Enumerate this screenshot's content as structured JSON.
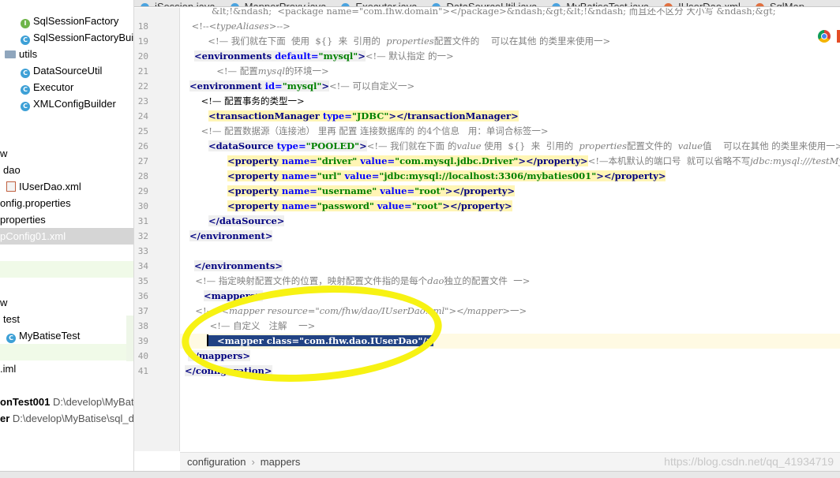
{
  "tabs": [
    {
      "label": "iSession.java"
    },
    {
      "label": "MapperProxy.java"
    },
    {
      "label": "Executor.java"
    },
    {
      "label": "DataSourceUtil.java"
    },
    {
      "label": "MyBatiseTest.java"
    },
    {
      "label": "IUserDao.xml"
    },
    {
      "label": "SqlMap"
    }
  ],
  "tree": {
    "items": [
      {
        "label": "SqlSessionFactory",
        "icon": "interface-icon"
      },
      {
        "label": "SqlSessionFactoryBuil",
        "icon": "class-icon"
      },
      {
        "label": "utils",
        "icon": "folder-icon"
      },
      {
        "label": "DataSourceUtil",
        "icon": "class-icon"
      },
      {
        "label": "Executor",
        "icon": "class-icon"
      },
      {
        "label": "XMLConfigBuilder",
        "icon": "class-icon"
      },
      {
        "label": "w"
      },
      {
        "label": "dao"
      },
      {
        "label": "IUserDao.xml",
        "icon": "xml-icon"
      },
      {
        "label": "onfig.properties"
      },
      {
        "label": "properties"
      },
      {
        "label": "pConfig01.xml"
      },
      {
        "label": "w"
      },
      {
        "label": "test"
      },
      {
        "label": "MyBatiseTest",
        "icon": "class-icon"
      },
      {
        "label": ".iml"
      }
    ],
    "projects": [
      {
        "name": "onTest001",
        "path": "D:\\develop\\MyBat"
      },
      {
        "name": "er",
        "path": "D:\\develop\\MyBatise\\sql_d"
      }
    ]
  },
  "editor": {
    "line_numbers": [
      "18",
      "19",
      "20",
      "21",
      "22",
      "23",
      "24",
      "25",
      "26",
      "27",
      "28",
      "29",
      "30",
      "31",
      "32",
      "33",
      "34",
      "35",
      "36",
      "37",
      "38",
      "39",
      "40",
      "41"
    ],
    "top_partial": "&lt;!&ndash;  <package name=\"com.fhw.domain\"></package>&ndash;&gt;&lt;!&ndash; 而且还不区分 大小写 &ndash;&gt;",
    "c18_pre": "    <!--",
    "c18_mid": "<typeAliases>",
    "c18_post": "-->",
    "c19_pre": "  <!— 我们就在下面  使用  ${}  来  引用的  ",
    "c19_it": "properties",
    "c19_post": "配置文件的    可以在其他 的类里来使用一>",
    "t20_open": "<environments",
    "a20_name": " default=",
    "s20_val": "\"mysql\"",
    "t20_close": ">",
    "c20": "<!— 默认指定 的一>",
    "c21_pre": "     <!— 配置",
    "c21_it": "mysql",
    "c21_post": "的环境一>",
    "t22_open": "<environment",
    "a22_name": " id=",
    "s22_val": "\"mysql\"",
    "t22_close": ">",
    "c22": "<!— 可以自定义一>",
    "c23": "    <!— 配置事务的类型一>",
    "t24_open": "<transactionManager",
    "a24_name": " type=",
    "s24_val": "\"JDBC\"",
    "t24_close": "></transactionManager>",
    "c25": "    <!— 配置数据源（连接池） 里再 配置 连接数据库的 的4个信息   用：单词合标签一>",
    "t26_open": "<dataSource",
    "a26_name": " type=",
    "s26_val": "\"POOLED\"",
    "t26_close": ">",
    "c26_pre": "<!— 我们就在下面 的",
    "c26_it1": "value",
    "c26_mid": " 使用  ${}  来  引用的  ",
    "c26_it2": "properties",
    "c26_mid2": "配置文件的  ",
    "c26_it3": "value",
    "c26_post": "值    可以在其他 的类里来使用一>",
    "props": [
      {
        "name": "\"driver\"",
        "value": "\"com.mysql.jdbc.Driver\"",
        "tail": "<!—本机默认的端口号  就可以省略不写",
        "tail_it": "jdbc:mysql:///testMy"
      },
      {
        "name": "\"url\"",
        "value": "\"jdbc:mysql://localhost:3306/mybaties001\"",
        "tail": "",
        "tail_it": ""
      },
      {
        "name": "\"username\"",
        "value": "\"root\"",
        "tail": "",
        "tail_it": ""
      },
      {
        "name": "\"password\"",
        "value": "\"root\"",
        "tail": "",
        "tail_it": ""
      }
    ],
    "prop_tag": "<property",
    "prop_name_attr": " name=",
    "prop_value_attr": " value=",
    "prop_close": "></property>",
    "t31": "</dataSource>",
    "t32": "</environment>",
    "t34": "</environments>",
    "c35_pre": "  <!— 指定映射配置文件的位置，映射配置文件指的是每个",
    "c35_it": "dao",
    "c35_post": "独立的配置文件  一>",
    "t36": "<mappers>",
    "c37_pre": "  <!— ",
    "c37_it": " <mapper resource=\"com/fhw/dao/IUserDao.xml\"></mapper>",
    "c37_post": "一>",
    "c38": "       <!— 自定义   注解    一>",
    "t39_open": "<mapper",
    "a39_name": " class=",
    "s39_val": "\"com.fhw.dao.IUserDao\"",
    "t39_close": "/>",
    "t40": "</mappers>",
    "t41": "</configuration>"
  },
  "breadcrumb": [
    "configuration",
    "mappers"
  ],
  "watermark": "https://blog.csdn.net/qq_41934719"
}
